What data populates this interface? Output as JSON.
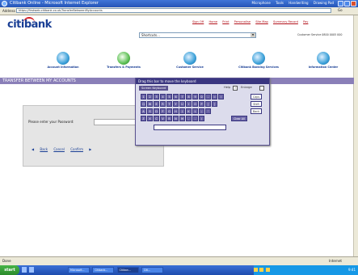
{
  "window": {
    "title": "Citibank Online - Microsoft Internet Explorer",
    "menu_links": [
      "Microphone",
      "Tools",
      "Handwriting",
      "Drawing Pad"
    ]
  },
  "address_bar": {
    "label": "Address",
    "url": "https://firstweb.citibank.co.uk/TransferBetweenMyAccounts",
    "go_label": "Go"
  },
  "header": {
    "logo": "citibank",
    "top_links": [
      "Sign Off",
      "Home",
      "Print",
      "Personalise",
      "Site Map",
      "Summary Record",
      "Pay"
    ],
    "shortcut_placeholder": "Shortcuts...",
    "customer_service": "Customer Service 0800 0005 000"
  },
  "nav": {
    "items": [
      {
        "label": "Account Information",
        "icon": "account-information-icon"
      },
      {
        "label": "Transfers & Payments",
        "icon": "transfers-payments-icon"
      },
      {
        "label": "Customer Service",
        "icon": "customer-service-icon"
      },
      {
        "label": "Citibank Banking Services",
        "icon": "banking-services-icon"
      },
      {
        "label": "Information Center",
        "icon": "information-center-icon"
      }
    ]
  },
  "page_title": "TRANSFER BETWEEN MY ACCOUNTS",
  "password_form": {
    "label": "Please enter your Password:",
    "links": [
      "Back",
      "Cancel",
      "Confirm"
    ]
  },
  "virtual_keyboard": {
    "header": "Drag this bar to move the keyboard",
    "tab": "Screen Keyboard",
    "help": "Help",
    "help_glyph": "?",
    "enlarge": "Enlarge",
    "rows": [
      [
        "1",
        "2",
        "3",
        "4",
        "5",
        "6",
        "7",
        "8",
        "9",
        "0",
        "-",
        "=",
        "\\"
      ],
      [
        "Q",
        "W",
        "E",
        "R",
        "T",
        "Y",
        "U",
        "I",
        "O",
        "P",
        "[",
        "]"
      ],
      [
        "A",
        "S",
        "D",
        "F",
        "G",
        "H",
        "J",
        "K",
        "L",
        ";",
        "'"
      ],
      [
        "Z",
        "X",
        "C",
        "V",
        "B",
        "N",
        "M",
        ",",
        ".",
        "/"
      ]
    ],
    "side_keys": [
      "Caps",
      "Shift",
      "Back"
    ],
    "clear_label": "Clear All"
  },
  "status_bar": {
    "left": "Done",
    "right": "Internet"
  },
  "taskbar": {
    "start": "start",
    "tasks": [
      "Microsoft...",
      "Citibank...",
      "Citiban...",
      "Citi..."
    ],
    "clock": "9:41"
  }
}
